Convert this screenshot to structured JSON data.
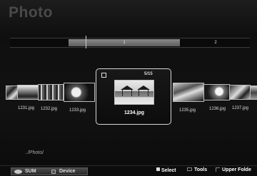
{
  "header": {
    "title": "Photo"
  },
  "page_indicator": {
    "current": "1",
    "next": "2"
  },
  "thumbnails": [
    {
      "name": "1231.jpg"
    },
    {
      "name": "1232.jpg"
    },
    {
      "name": "1233.jpg"
    },
    {
      "name": "1235.jpg"
    },
    {
      "name": "1236.jpg"
    },
    {
      "name": "1237.jpg"
    }
  ],
  "focused": {
    "name": "1234.jpg",
    "count": "5/15"
  },
  "path": "../Photo/",
  "bottom_bar": {
    "sum_label": "SUM",
    "device_label": "Device",
    "select_label": "Select",
    "tools_label": "Tools",
    "upper_folder_label": "Upper Folde"
  }
}
